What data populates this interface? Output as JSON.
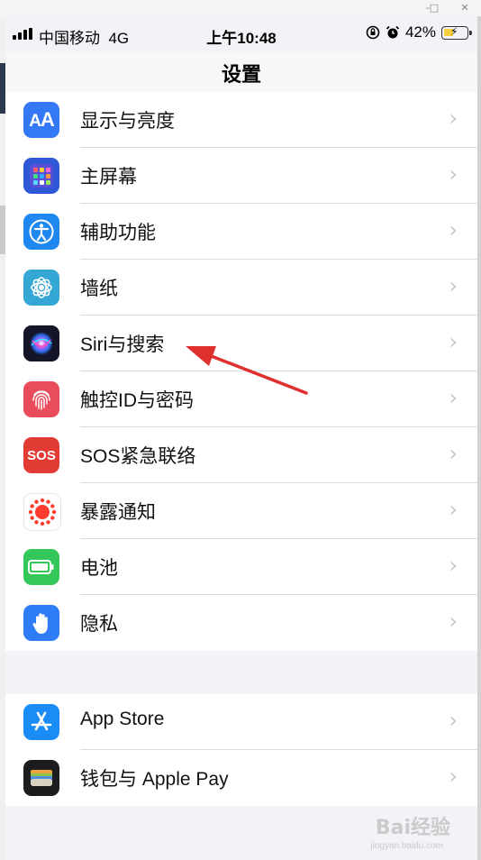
{
  "status_bar": {
    "carrier": "中国移动",
    "network": "4G",
    "time": "上午10:48",
    "battery": "42%",
    "battery_level": 0.42
  },
  "nav": {
    "title": "设置"
  },
  "window": {
    "minimize": "–",
    "maximize": "□",
    "close": "✕"
  },
  "groups": [
    {
      "items": [
        {
          "label": "显示与亮度",
          "icon": "display-brightness-icon",
          "color": "#3478f6"
        },
        {
          "label": "主屏幕",
          "icon": "home-screen-icon",
          "color": "#2f58d6"
        },
        {
          "label": "辅助功能",
          "icon": "accessibility-icon",
          "color": "#1e87f0"
        },
        {
          "label": "墙纸",
          "icon": "wallpaper-icon",
          "color": "#35a7d4"
        },
        {
          "label": "Siri与搜索",
          "icon": "siri-icon",
          "color": "#1c1c2e"
        },
        {
          "label": "触控ID与密码",
          "icon": "fingerprint-icon",
          "color": "#e94c5b"
        },
        {
          "label": "SOS紧急联络",
          "icon": "sos-icon",
          "color": "#e23b34"
        },
        {
          "label": "暴露通知",
          "icon": "exposure-notification-icon",
          "color": "#ffffff"
        },
        {
          "label": "电池",
          "icon": "battery-icon",
          "color": "#34c759"
        },
        {
          "label": "隐私",
          "icon": "privacy-hand-icon",
          "color": "#2f7df6"
        }
      ]
    },
    {
      "items": [
        {
          "label": "App Store",
          "icon": "app-store-icon",
          "color": "#1a8cf5"
        },
        {
          "label": "钱包与 Apple Pay",
          "icon": "wallet-icon",
          "color": "#1c1c1e"
        }
      ]
    }
  ],
  "sos_icon_text": "SOS",
  "watermark": {
    "text": "Bai经验",
    "sub": "jingyan.baidu.com"
  }
}
